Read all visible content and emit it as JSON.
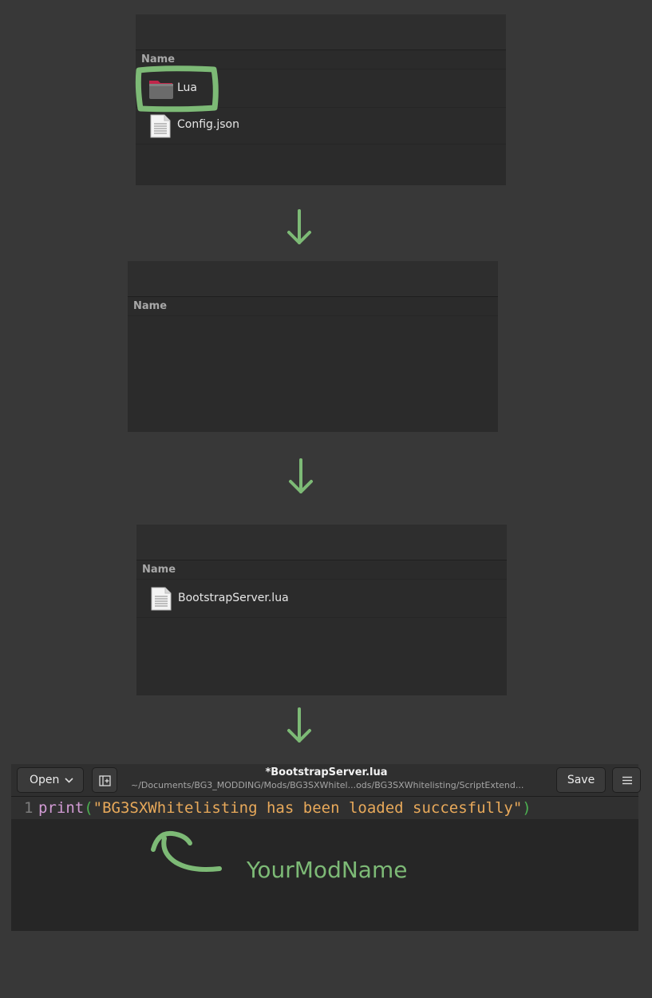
{
  "panels": [
    {
      "column_header": "Name",
      "rows": [
        {
          "label": "Lua",
          "icon": "folder-icon"
        },
        {
          "label": "Config.json",
          "icon": "file-icon"
        }
      ]
    },
    {
      "column_header": "Name",
      "rows": []
    },
    {
      "column_header": "Name",
      "rows": [
        {
          "label": "BootstrapServer.lua",
          "icon": "file-icon"
        }
      ]
    }
  ],
  "editor": {
    "open_label": "Open",
    "title": "*BootstrapServer.lua",
    "path": "~/Documents/BG3_MODDING/Mods/BG3SXWhitel...ods/BG3SXWhitelisting/ScriptExtend...",
    "save_label": "Save",
    "line_number": "1",
    "code": {
      "keyword": "print",
      "open_paren": "(",
      "string": "\"BG3SXWhitelisting has been loaded succesfully\"",
      "close_paren": ")"
    }
  },
  "annotation": "YourModName",
  "colors": {
    "highlight": "#7dba76",
    "background": "#383838",
    "panel": "#2b2b2b"
  }
}
